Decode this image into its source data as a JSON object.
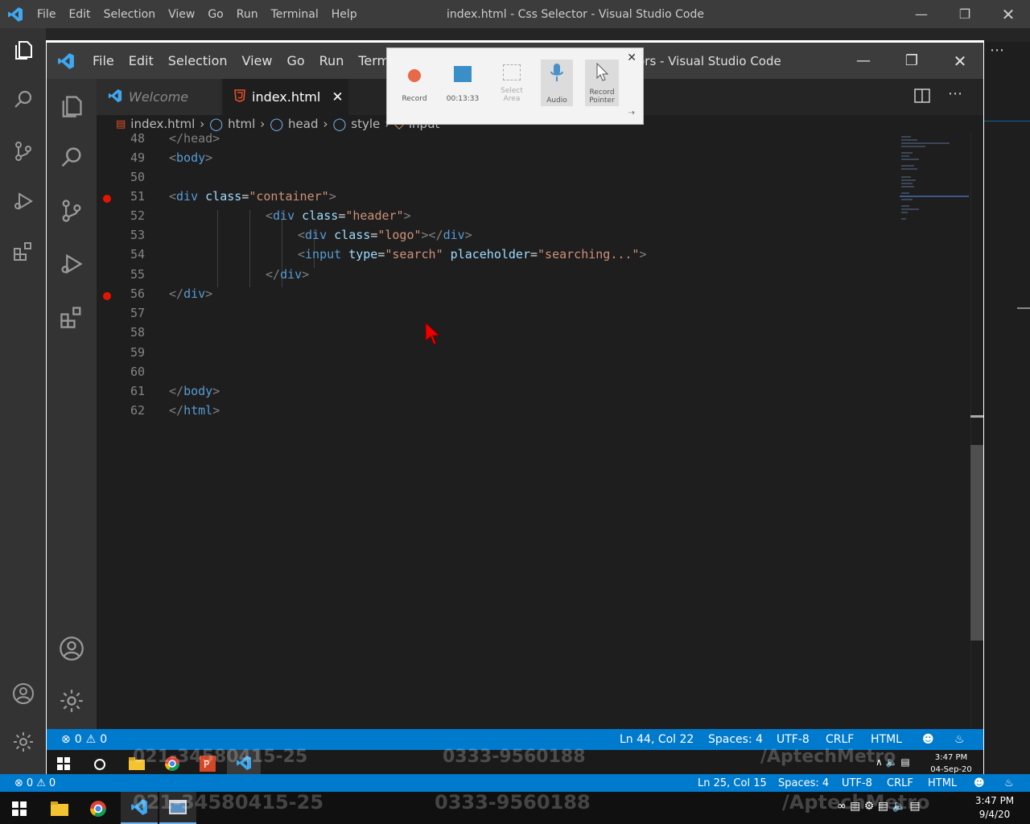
{
  "outer": {
    "menu": [
      "File",
      "Edit",
      "Selection",
      "View",
      "Go",
      "Run",
      "Terminal",
      "Help"
    ],
    "window_title": "index.html - Css Selector - Visual Studio Code",
    "status": {
      "errors": "0",
      "warnings": "0",
      "position": "Ln 25, Col 15",
      "spaces": "Spaces: 4",
      "encoding": "UTF-8",
      "eol": "CRLF",
      "language": "HTML"
    },
    "taskbar": {
      "time": "3:47 PM",
      "date": "9/4/20"
    }
  },
  "inner": {
    "menu": [
      "File",
      "Edit",
      "Selection",
      "View",
      "Go",
      "Run",
      "Terminal"
    ],
    "window_title_fragment": "ctors - Visual Studio Code",
    "tabs": [
      {
        "label": "Welcome"
      },
      {
        "label": "index.html"
      }
    ],
    "breadcrumb": [
      "index.html",
      "html",
      "head",
      "style",
      "input"
    ],
    "status": {
      "errors": "0",
      "warnings": "0",
      "position": "Ln 44, Col 22",
      "spaces": "Spaces: 4",
      "encoding": "UTF-8",
      "eol": "CRLF",
      "language": "HTML"
    },
    "taskbar": {
      "time": "3:47 PM",
      "date": "04-Sep-20"
    }
  },
  "code_lines": [
    {
      "num": "48"
    },
    {
      "num": "49"
    },
    {
      "num": "50"
    },
    {
      "num": "51"
    },
    {
      "num": "52"
    },
    {
      "num": "53"
    },
    {
      "num": "54"
    },
    {
      "num": "55"
    },
    {
      "num": "56"
    },
    {
      "num": "57"
    },
    {
      "num": "58"
    },
    {
      "num": "59"
    },
    {
      "num": "60"
    },
    {
      "num": "61"
    },
    {
      "num": "62"
    }
  ],
  "code": {
    "l48": "</head>",
    "l49_tag": "body",
    "l51_tag": "div",
    "l51_attr": "class",
    "l51_val": "\"container\"",
    "l52_tag": "div",
    "l52_attr": "class",
    "l52_val": "\"header\"",
    "l53_tag": "div",
    "l53_attr": "class",
    "l53_val": "\"logo\"",
    "l53_close": "div",
    "l54_tag": "input",
    "l54_attr1": "type",
    "l54_val1": "\"search\"",
    "l54_attr2": "placeholder",
    "l54_val2": "\"searching...\"",
    "l55_tag": "div",
    "l56_tag": "div",
    "l61_tag": "body",
    "l62_tag": "html"
  },
  "recorder": {
    "record_label": "Record",
    "timer": "00:13:33",
    "select_area_label": "Select Area",
    "audio_label": "Audio",
    "record_pointer_label": "Record Pointer"
  },
  "watermark": {
    "phone1": "021-34580415-25",
    "phone2": "0333-9560188",
    "handle": "/AptechMetro"
  },
  "colors": {
    "statusbar": "#007acc",
    "titlebar": "#3c3c3c",
    "activitybar": "#333333",
    "editor": "#1e1e1e",
    "breakpoint": "#e51400"
  }
}
